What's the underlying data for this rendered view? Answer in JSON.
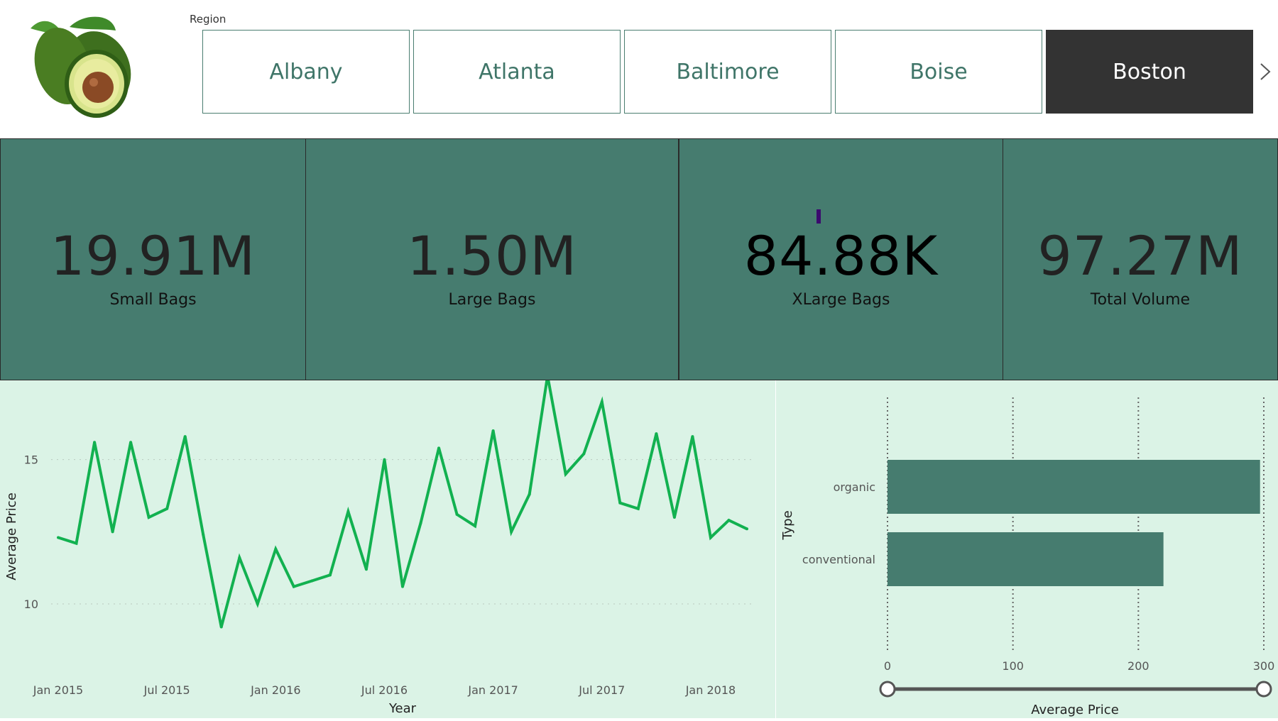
{
  "header": {
    "slicer_title": "Region",
    "regions": [
      "Albany",
      "Atlanta",
      "Baltimore",
      "Boise",
      "Boston"
    ],
    "selected_region": "Boston",
    "next_icon": "chevron-right-icon"
  },
  "cards": {
    "small_bags": {
      "value": "19.91M",
      "label": "Small Bags"
    },
    "large_bags": {
      "value": "1.50M",
      "label": "Large Bags"
    },
    "xlarge_bags": {
      "value": "84.88K",
      "label": "XLarge Bags"
    },
    "total_volume": {
      "value": "97.27M",
      "label": "Total Volume"
    }
  },
  "colors": {
    "card_bg": "#467c6f",
    "panel_bg": "#dbf3e6",
    "line": "#12b150",
    "bar": "#467c6f",
    "selected_bg": "#333333"
  },
  "chart_data": [
    {
      "type": "line",
      "xlabel": "Year",
      "ylabel": "Average Price",
      "x_ticks": [
        "Jan 2015",
        "Jul 2015",
        "Jan 2016",
        "Jul 2016",
        "Jan 2017",
        "Jul 2017",
        "Jan 2018"
      ],
      "y_ticks": [
        10,
        15
      ],
      "ylim": [
        8.5,
        17.5
      ],
      "x": [
        "2015-01",
        "2015-02",
        "2015-03",
        "2015-04",
        "2015-05",
        "2015-06",
        "2015-07",
        "2015-08",
        "2015-09",
        "2015-10",
        "2015-11",
        "2015-12",
        "2016-01",
        "2016-02",
        "2016-03",
        "2016-04",
        "2016-05",
        "2016-06",
        "2016-07",
        "2016-08",
        "2016-09",
        "2016-10",
        "2016-11",
        "2016-12",
        "2017-01",
        "2017-02",
        "2017-03",
        "2017-04",
        "2017-05",
        "2017-06",
        "2017-07",
        "2017-08",
        "2017-09",
        "2017-10",
        "2017-11",
        "2017-12",
        "2018-01",
        "2018-02",
        "2018-03"
      ],
      "series": [
        {
          "values": [
            12.3,
            12.1,
            15.6,
            12.5,
            15.6,
            13.0,
            13.3,
            15.8,
            12.4,
            9.2,
            11.6,
            10.0,
            11.9,
            10.6,
            10.8,
            11.0,
            13.2,
            11.2,
            15.0,
            10.6,
            12.8,
            15.4,
            13.1,
            12.7,
            16.0,
            12.5,
            13.8,
            17.9,
            14.5,
            15.2,
            17.0,
            13.5,
            13.3,
            15.9,
            13.0,
            15.8,
            12.3,
            12.9,
            12.6
          ]
        }
      ],
      "grid": true
    },
    {
      "type": "bar",
      "orientation": "horizontal",
      "ylabel": "Type",
      "xlabel": "Average Price",
      "categories": [
        "organic",
        "conventional"
      ],
      "values": [
        297,
        220
      ],
      "xlim": [
        0,
        300
      ],
      "x_ticks": [
        0,
        100,
        200,
        300
      ],
      "grid": true,
      "range_slider": [
        0,
        300
      ]
    }
  ]
}
